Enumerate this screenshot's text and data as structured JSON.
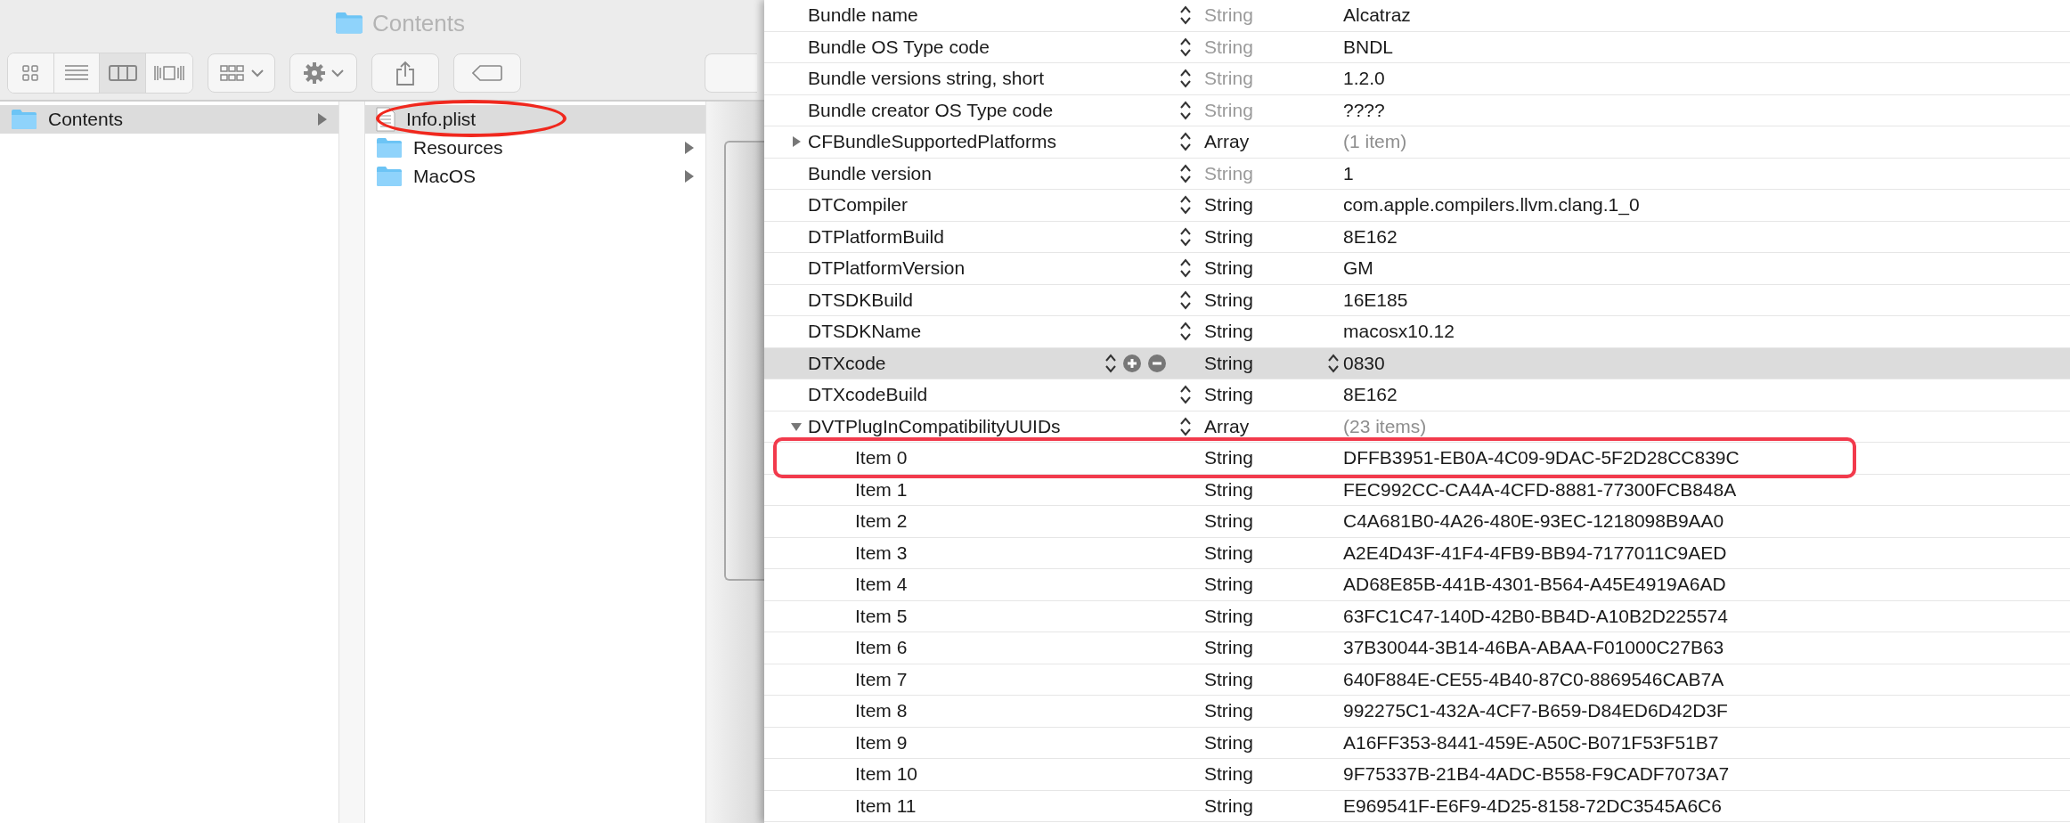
{
  "finder": {
    "title": "Contents",
    "columns": [
      {
        "items": [
          {
            "name": "Contents",
            "kind": "folder",
            "selected": true,
            "has_children": true,
            "circled": false
          }
        ]
      },
      {
        "items": [
          {
            "name": "Info.plist",
            "kind": "file",
            "selected": true,
            "has_children": false,
            "circled": true
          },
          {
            "name": "Resources",
            "kind": "folder",
            "selected": false,
            "has_children": true,
            "circled": false
          },
          {
            "name": "MacOS",
            "kind": "folder",
            "selected": false,
            "has_children": true,
            "circled": false
          }
        ]
      }
    ]
  },
  "plist": {
    "rows": [
      {
        "key": "Bundle name",
        "type": "String",
        "value": "Alcatraz",
        "type_muted": true,
        "value_muted": false,
        "selected": false
      },
      {
        "key": "Bundle OS Type code",
        "type": "String",
        "value": "BNDL",
        "type_muted": true,
        "value_muted": false,
        "selected": false
      },
      {
        "key": "Bundle versions string, short",
        "type": "String",
        "value": "1.2.0",
        "type_muted": true,
        "value_muted": false,
        "selected": false
      },
      {
        "key": "Bundle creator OS Type code",
        "type": "String",
        "value": "????",
        "type_muted": true,
        "value_muted": false,
        "selected": false
      },
      {
        "key": "CFBundleSupportedPlatforms",
        "type": "Array",
        "value": "(1 item)",
        "type_muted": false,
        "value_muted": true,
        "selected": false,
        "expanded": false
      },
      {
        "key": "Bundle version",
        "type": "String",
        "value": "1",
        "type_muted": true,
        "value_muted": false,
        "selected": false
      },
      {
        "key": "DTCompiler",
        "type": "String",
        "value": "com.apple.compilers.llvm.clang.1_0",
        "type_muted": false,
        "value_muted": false,
        "selected": false
      },
      {
        "key": "DTPlatformBuild",
        "type": "String",
        "value": "8E162",
        "type_muted": false,
        "value_muted": false,
        "selected": false
      },
      {
        "key": "DTPlatformVersion",
        "type": "String",
        "value": "GM",
        "type_muted": false,
        "value_muted": false,
        "selected": false
      },
      {
        "key": "DTSDKBuild",
        "type": "String",
        "value": "16E185",
        "type_muted": false,
        "value_muted": false,
        "selected": false
      },
      {
        "key": "DTSDKName",
        "type": "String",
        "value": "macosx10.12",
        "type_muted": false,
        "value_muted": false,
        "selected": false
      },
      {
        "key": "DTXcode",
        "type": "String",
        "value": "0830",
        "type_muted": false,
        "value_muted": false,
        "selected": true
      },
      {
        "key": "DTXcodeBuild",
        "type": "String",
        "value": "8E162",
        "type_muted": false,
        "value_muted": false,
        "selected": false
      },
      {
        "key": "DVTPlugInCompatibilityUUIDs",
        "type": "Array",
        "value": "(23 items)",
        "type_muted": false,
        "value_muted": true,
        "selected": false,
        "expanded": true,
        "children": [
          {
            "key": "Item 0",
            "type": "String",
            "value": "DFFB3951-EB0A-4C09-9DAC-5F2D28CC839C",
            "highlighted": true
          },
          {
            "key": "Item 1",
            "type": "String",
            "value": "FEC992CC-CA4A-4CFD-8881-77300FCB848A",
            "highlighted": false
          },
          {
            "key": "Item 2",
            "type": "String",
            "value": "C4A681B0-4A26-480E-93EC-1218098B9AA0",
            "highlighted": false
          },
          {
            "key": "Item 3",
            "type": "String",
            "value": "A2E4D43F-41F4-4FB9-BB94-7177011C9AED",
            "highlighted": false
          },
          {
            "key": "Item 4",
            "type": "String",
            "value": "AD68E85B-441B-4301-B564-A45E4919A6AD",
            "highlighted": false
          },
          {
            "key": "Item 5",
            "type": "String",
            "value": "63FC1C47-140D-42B0-BB4D-A10B2D225574",
            "highlighted": false
          },
          {
            "key": "Item 6",
            "type": "String",
            "value": "37B30044-3B14-46BA-ABAA-F01000C27B63",
            "highlighted": false
          },
          {
            "key": "Item 7",
            "type": "String",
            "value": "640F884E-CE55-4B40-87C0-8869546CAB7A",
            "highlighted": false
          },
          {
            "key": "Item 8",
            "type": "String",
            "value": "992275C1-432A-4CF7-B659-D84ED6D42D3F",
            "highlighted": false
          },
          {
            "key": "Item 9",
            "type": "String",
            "value": "A16FF353-8441-459E-A50C-B071F53F51B7",
            "highlighted": false
          },
          {
            "key": "Item 10",
            "type": "String",
            "value": "9F75337B-21B4-4ADC-B558-F9CADF7073A7",
            "highlighted": false
          },
          {
            "key": "Item 11",
            "type": "String",
            "value": "E969541F-E6F9-4D25-8158-72DC3545A6C6",
            "highlighted": false
          }
        ]
      }
    ]
  }
}
